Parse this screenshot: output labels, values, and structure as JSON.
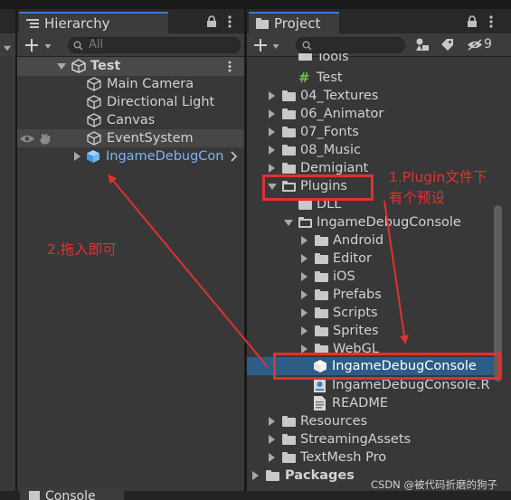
{
  "hierarchy": {
    "title": "Hierarchy",
    "search_placeholder": "All",
    "scene": "Test",
    "items": [
      {
        "label": "Main Camera"
      },
      {
        "label": "Directional Light"
      },
      {
        "label": "Canvas"
      },
      {
        "label": "EventSystem"
      },
      {
        "label": "IngameDebugCon"
      }
    ]
  },
  "project": {
    "title": "Project",
    "hidden_count": "9",
    "items": [
      {
        "label": "Tools"
      },
      {
        "label": "Test"
      },
      {
        "label": "04_Textures"
      },
      {
        "label": "06_Animator"
      },
      {
        "label": "07_Fonts"
      },
      {
        "label": "08_Music"
      },
      {
        "label": "Demigiant"
      },
      {
        "label": "Plugins"
      },
      {
        "label": "DLL"
      },
      {
        "label": "IngameDebugConsole"
      },
      {
        "label": "Android"
      },
      {
        "label": "Editor"
      },
      {
        "label": "iOS"
      },
      {
        "label": "Prefabs"
      },
      {
        "label": "Scripts"
      },
      {
        "label": "Sprites"
      },
      {
        "label": "WebGL"
      },
      {
        "label": "IngameDebugConsole"
      },
      {
        "label": "IngameDebugConsole.R"
      },
      {
        "label": "README"
      },
      {
        "label": "Resources"
      },
      {
        "label": "StreamingAssets"
      },
      {
        "label": "TextMesh Pro"
      },
      {
        "label": "Packages"
      }
    ]
  },
  "console_tab": "Console",
  "annotations": {
    "note1_line1": "1.Plugin文件下",
    "note1_line2": "有个预设",
    "note2": "2.拖入即可",
    "watermark": "CSDN @被代码折磨的狗子"
  },
  "colors": {
    "accent": "#3a7ad7",
    "selection": "#2c5d87",
    "annotation_red": "#e03131"
  }
}
